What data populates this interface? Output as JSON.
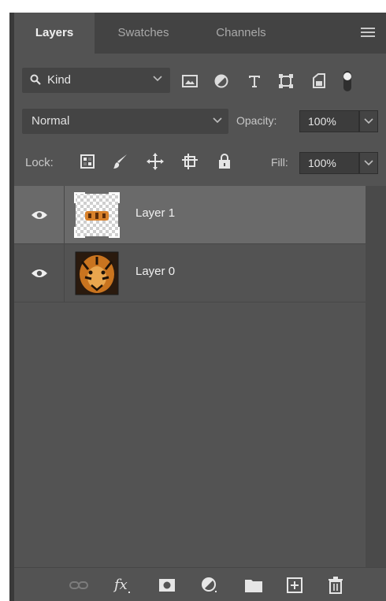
{
  "tabs": [
    {
      "label": "Layers",
      "active": true
    },
    {
      "label": "Swatches",
      "active": false
    },
    {
      "label": "Channels",
      "active": false
    }
  ],
  "filter": {
    "kind_label": "Kind",
    "icons": [
      "image-filter-icon",
      "adjustment-filter-icon",
      "type-filter-icon",
      "shape-filter-icon",
      "smart-object-filter-icon",
      "filter-toggle-icon"
    ]
  },
  "blend": {
    "mode": "Normal",
    "opacity_label": "Opacity:",
    "opacity_value": "100%"
  },
  "lock": {
    "label": "Lock:",
    "icons": [
      "lock-transparent-pixels-icon",
      "lock-image-pixels-icon",
      "lock-position-icon",
      "lock-artboard-icon",
      "lock-all-icon"
    ],
    "fill_label": "Fill:",
    "fill_value": "100%"
  },
  "layers": [
    {
      "name": "Layer 1",
      "selected": true,
      "visible": true
    },
    {
      "name": "Layer 0",
      "selected": false,
      "visible": true
    }
  ],
  "footer_icons": [
    "link-layers-icon",
    "fx-icon",
    "add-mask-icon",
    "adjustment-layer-icon",
    "new-group-icon",
    "new-layer-icon",
    "delete-layer-icon"
  ],
  "colors": {
    "panel_bg": "#535353",
    "selected_row": "#6a6a6a",
    "tab_bar": "#434343"
  }
}
